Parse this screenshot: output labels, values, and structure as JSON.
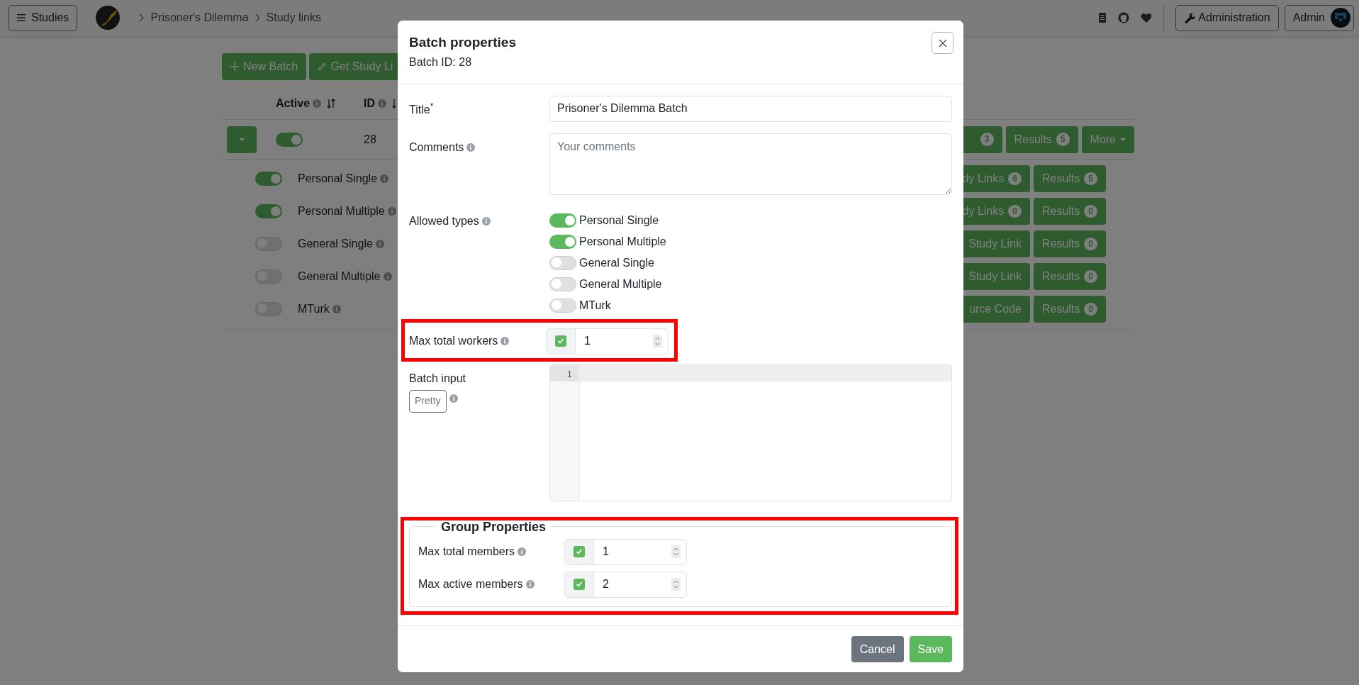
{
  "navbar": {
    "studies_button": "Studies",
    "breadcrumbs": [
      "Prisoner's Dilemma",
      "Study links"
    ],
    "admin_button": "Administration",
    "user_button": "Admin"
  },
  "toolbar": {
    "buttons": [
      "New Batch",
      "Get Study Li"
    ]
  },
  "batch_table": {
    "columns": [
      "Active",
      "ID"
    ],
    "batch": {
      "active": true,
      "id": "28",
      "buttons": [
        {
          "kind": "badge-only",
          "badge": "3"
        },
        {
          "kind": "button",
          "label": "Results",
          "badge": "5"
        },
        {
          "kind": "dropdown",
          "label": "More"
        }
      ]
    },
    "rows": [
      {
        "label": "Personal Single",
        "on": true,
        "buttons": [
          {
            "label": "dy Links",
            "badge": "6"
          },
          {
            "label": "Results",
            "badge": "5"
          }
        ]
      },
      {
        "label": "Personal Multiple",
        "on": true,
        "buttons": [
          {
            "label": "dy Links",
            "badge": "0"
          },
          {
            "label": "Results",
            "badge": "0"
          }
        ]
      },
      {
        "label": "General Single",
        "on": false,
        "buttons": [
          {
            "label": "Study Link"
          },
          {
            "label": "Results",
            "badge": "0"
          }
        ]
      },
      {
        "label": "General Multiple",
        "on": false,
        "buttons": [
          {
            "label": "Study Link"
          },
          {
            "label": "Results",
            "badge": "0"
          }
        ]
      },
      {
        "label": "MTurk",
        "on": false,
        "buttons": [
          {
            "label": "urce Code"
          },
          {
            "label": "Results",
            "badge": "0"
          }
        ]
      }
    ]
  },
  "modal": {
    "title": "Batch properties",
    "subtitle": "Batch ID: 28",
    "title_field": {
      "label": "Title",
      "required_mark": "*",
      "value": "Prisoner's Dilemma Batch"
    },
    "comments_field": {
      "label": "Comments",
      "placeholder": "Your comments"
    },
    "allowed_types": {
      "label": "Allowed types",
      "options": [
        {
          "label": "Personal Single",
          "on": true
        },
        {
          "label": "Personal Multiple",
          "on": true
        },
        {
          "label": "General Single",
          "on": false
        },
        {
          "label": "General Multiple",
          "on": false
        },
        {
          "label": "MTurk",
          "on": false
        }
      ]
    },
    "max_total_workers": {
      "label": "Max total workers",
      "enabled": true,
      "value": "1",
      "highlighted": true
    },
    "batch_input": {
      "label": "Batch input",
      "pretty_button": "Pretty",
      "line_numbers": [
        "1"
      ]
    },
    "group_properties": {
      "legend": "Group Properties",
      "highlighted": true,
      "fields": [
        {
          "label": "Max total members",
          "enabled": true,
          "value": "1"
        },
        {
          "label": "Max active members",
          "enabled": true,
          "value": "2"
        }
      ]
    },
    "footer_buttons": [
      {
        "label": "Cancel",
        "kind": "secondary"
      },
      {
        "label": "Save",
        "kind": "primary"
      }
    ]
  }
}
